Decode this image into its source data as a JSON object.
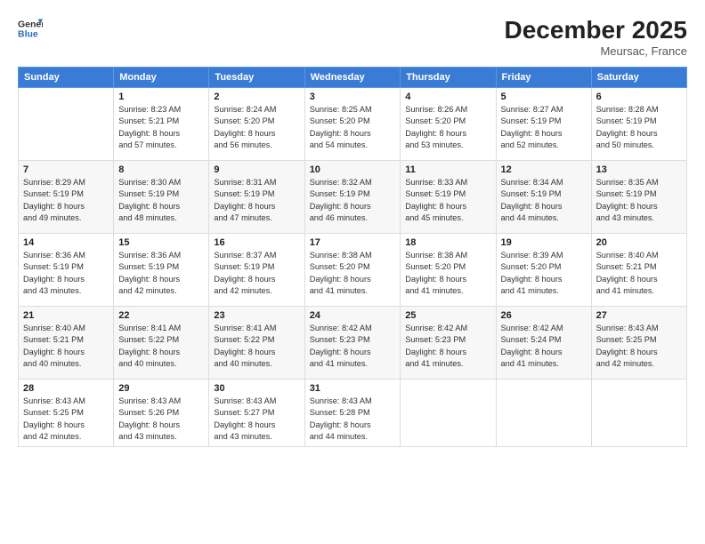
{
  "header": {
    "logo_line1": "General",
    "logo_line2": "Blue",
    "month": "December 2025",
    "location": "Meursac, France"
  },
  "weekdays": [
    "Sunday",
    "Monday",
    "Tuesday",
    "Wednesday",
    "Thursday",
    "Friday",
    "Saturday"
  ],
  "weeks": [
    [
      {
        "day": "",
        "info": ""
      },
      {
        "day": "1",
        "info": "Sunrise: 8:23 AM\nSunset: 5:21 PM\nDaylight: 8 hours\nand 57 minutes."
      },
      {
        "day": "2",
        "info": "Sunrise: 8:24 AM\nSunset: 5:20 PM\nDaylight: 8 hours\nand 56 minutes."
      },
      {
        "day": "3",
        "info": "Sunrise: 8:25 AM\nSunset: 5:20 PM\nDaylight: 8 hours\nand 54 minutes."
      },
      {
        "day": "4",
        "info": "Sunrise: 8:26 AM\nSunset: 5:20 PM\nDaylight: 8 hours\nand 53 minutes."
      },
      {
        "day": "5",
        "info": "Sunrise: 8:27 AM\nSunset: 5:19 PM\nDaylight: 8 hours\nand 52 minutes."
      },
      {
        "day": "6",
        "info": "Sunrise: 8:28 AM\nSunset: 5:19 PM\nDaylight: 8 hours\nand 50 minutes."
      }
    ],
    [
      {
        "day": "7",
        "info": "Sunrise: 8:29 AM\nSunset: 5:19 PM\nDaylight: 8 hours\nand 49 minutes."
      },
      {
        "day": "8",
        "info": "Sunrise: 8:30 AM\nSunset: 5:19 PM\nDaylight: 8 hours\nand 48 minutes."
      },
      {
        "day": "9",
        "info": "Sunrise: 8:31 AM\nSunset: 5:19 PM\nDaylight: 8 hours\nand 47 minutes."
      },
      {
        "day": "10",
        "info": "Sunrise: 8:32 AM\nSunset: 5:19 PM\nDaylight: 8 hours\nand 46 minutes."
      },
      {
        "day": "11",
        "info": "Sunrise: 8:33 AM\nSunset: 5:19 PM\nDaylight: 8 hours\nand 45 minutes."
      },
      {
        "day": "12",
        "info": "Sunrise: 8:34 AM\nSunset: 5:19 PM\nDaylight: 8 hours\nand 44 minutes."
      },
      {
        "day": "13",
        "info": "Sunrise: 8:35 AM\nSunset: 5:19 PM\nDaylight: 8 hours\nand 43 minutes."
      }
    ],
    [
      {
        "day": "14",
        "info": "Sunrise: 8:36 AM\nSunset: 5:19 PM\nDaylight: 8 hours\nand 43 minutes."
      },
      {
        "day": "15",
        "info": "Sunrise: 8:36 AM\nSunset: 5:19 PM\nDaylight: 8 hours\nand 42 minutes."
      },
      {
        "day": "16",
        "info": "Sunrise: 8:37 AM\nSunset: 5:19 PM\nDaylight: 8 hours\nand 42 minutes."
      },
      {
        "day": "17",
        "info": "Sunrise: 8:38 AM\nSunset: 5:20 PM\nDaylight: 8 hours\nand 41 minutes."
      },
      {
        "day": "18",
        "info": "Sunrise: 8:38 AM\nSunset: 5:20 PM\nDaylight: 8 hours\nand 41 minutes."
      },
      {
        "day": "19",
        "info": "Sunrise: 8:39 AM\nSunset: 5:20 PM\nDaylight: 8 hours\nand 41 minutes."
      },
      {
        "day": "20",
        "info": "Sunrise: 8:40 AM\nSunset: 5:21 PM\nDaylight: 8 hours\nand 41 minutes."
      }
    ],
    [
      {
        "day": "21",
        "info": "Sunrise: 8:40 AM\nSunset: 5:21 PM\nDaylight: 8 hours\nand 40 minutes."
      },
      {
        "day": "22",
        "info": "Sunrise: 8:41 AM\nSunset: 5:22 PM\nDaylight: 8 hours\nand 40 minutes."
      },
      {
        "day": "23",
        "info": "Sunrise: 8:41 AM\nSunset: 5:22 PM\nDaylight: 8 hours\nand 40 minutes."
      },
      {
        "day": "24",
        "info": "Sunrise: 8:42 AM\nSunset: 5:23 PM\nDaylight: 8 hours\nand 41 minutes."
      },
      {
        "day": "25",
        "info": "Sunrise: 8:42 AM\nSunset: 5:23 PM\nDaylight: 8 hours\nand 41 minutes."
      },
      {
        "day": "26",
        "info": "Sunrise: 8:42 AM\nSunset: 5:24 PM\nDaylight: 8 hours\nand 41 minutes."
      },
      {
        "day": "27",
        "info": "Sunrise: 8:43 AM\nSunset: 5:25 PM\nDaylight: 8 hours\nand 42 minutes."
      }
    ],
    [
      {
        "day": "28",
        "info": "Sunrise: 8:43 AM\nSunset: 5:25 PM\nDaylight: 8 hours\nand 42 minutes."
      },
      {
        "day": "29",
        "info": "Sunrise: 8:43 AM\nSunset: 5:26 PM\nDaylight: 8 hours\nand 43 minutes."
      },
      {
        "day": "30",
        "info": "Sunrise: 8:43 AM\nSunset: 5:27 PM\nDaylight: 8 hours\nand 43 minutes."
      },
      {
        "day": "31",
        "info": "Sunrise: 8:43 AM\nSunset: 5:28 PM\nDaylight: 8 hours\nand 44 minutes."
      },
      {
        "day": "",
        "info": ""
      },
      {
        "day": "",
        "info": ""
      },
      {
        "day": "",
        "info": ""
      }
    ]
  ]
}
